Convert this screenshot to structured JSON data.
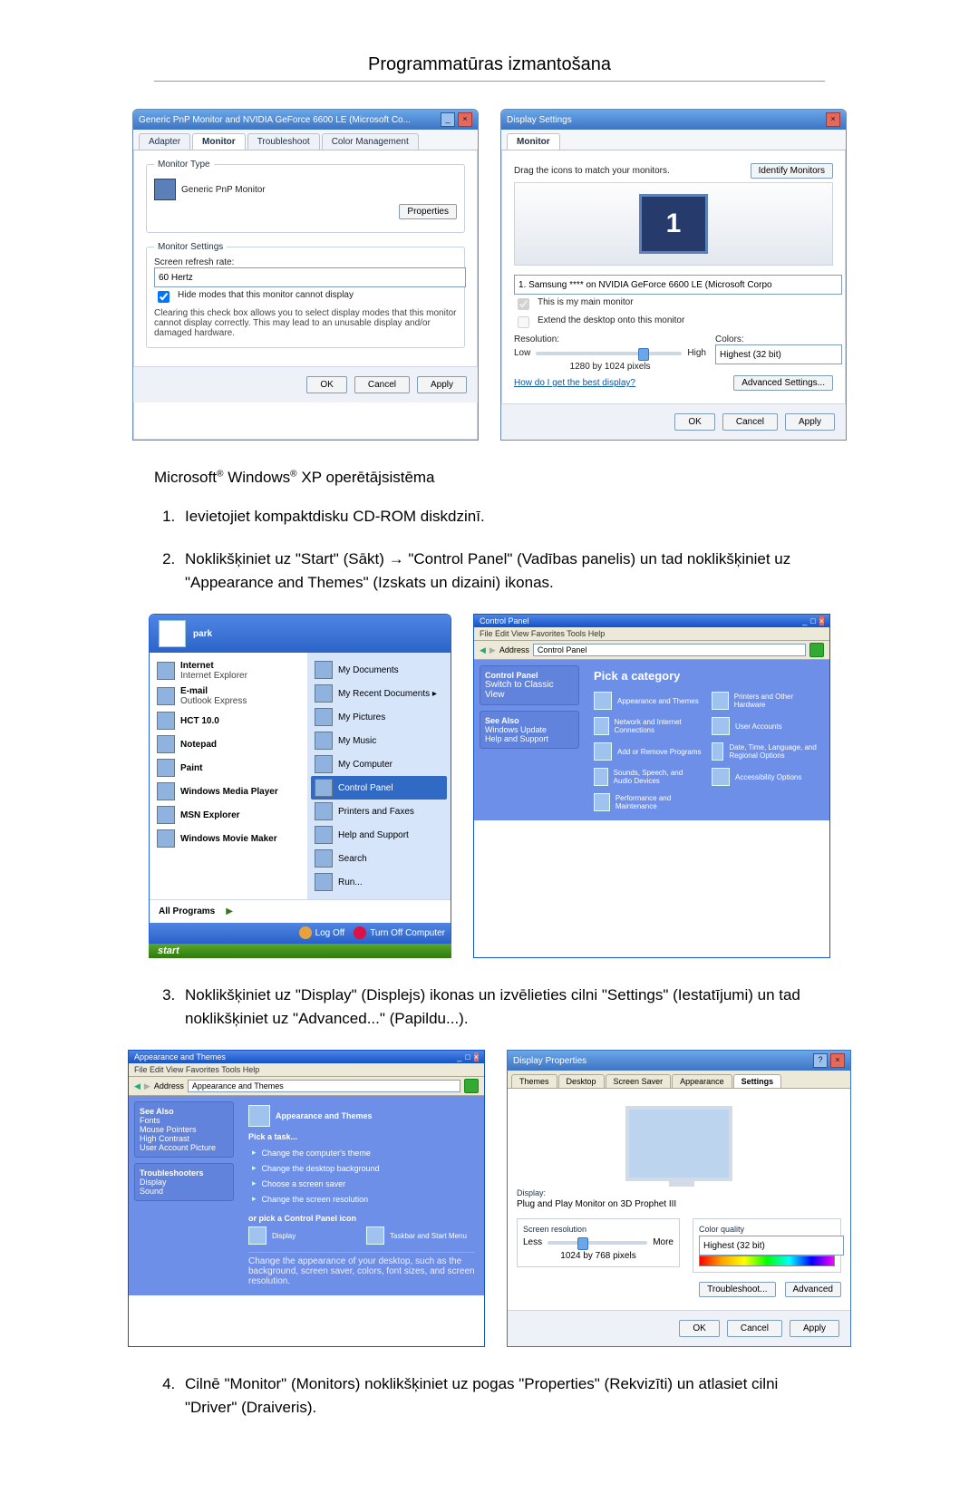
{
  "header": "Programmatūras izmantošana",
  "fig1": {
    "left": {
      "title": "Generic PnP Monitor and NVIDIA GeForce 6600 LE (Microsoft Co...",
      "tabs": [
        "Adapter",
        "Monitor",
        "Troubleshoot",
        "Color Management"
      ],
      "tab_sel": 1,
      "group1": "Monitor Type",
      "mon_name": "Generic PnP Monitor",
      "btn_props": "Properties",
      "group2": "Monitor Settings",
      "lbl_refresh": "Screen refresh rate:",
      "refresh_val": "60 Hertz",
      "chk_hide": "Hide modes that this monitor cannot display",
      "hide_desc": "Clearing this check box allows you to select display modes that this monitor cannot display correctly. This may lead to an unusable display and/or damaged hardware.",
      "ok": "OK",
      "cancel": "Cancel",
      "apply": "Apply"
    },
    "right": {
      "title": "Display Settings",
      "tab": "Monitor",
      "drag": "Drag the icons to match your monitors.",
      "btn_ident": "Identify Monitors",
      "mon_num": "1",
      "sel_mon": "1. Samsung **** on NVIDIA GeForce 6600 LE (Microsoft Corpo",
      "chk_main": "This is my main monitor",
      "chk_ext": "Extend the desktop onto this monitor",
      "lbl_res": "Resolution:",
      "lbl_low": "Low",
      "lbl_high": "High",
      "res_val": "1280 by 1024 pixels",
      "lbl_col": "Colors:",
      "col_val": "Highest (32 bit)",
      "link_best": "How do I get the best display?",
      "btn_adv": "Advanced Settings...",
      "ok": "OK",
      "cancel": "Cancel",
      "apply": "Apply"
    }
  },
  "xp_line": "Microsoft® Windows® XP operētājsistēma",
  "steps": {
    "s1": "Ievietojiet kompaktdisku CD-ROM diskdzinī.",
    "s2": "Noklikšķiniet uz \"Start\" (Sākt) → \"Control Panel\" (Vadības panelis) un tad noklikšķiniet uz \"Appearance and Themes\" (Izskats un dizaini) ikonas.",
    "s3": "Noklikšķiniet uz \"Display\" (Displejs) ikonas un izvēlieties cilni \"Settings\" (Iestatījumi) un tad noklikšķiniet uz \"Advanced...\" (Papildu...).",
    "s4": "Cilnē \"Monitor\" (Monitors) noklikšķiniet uz pogas \"Properties\" (Rekvizīti) un atlasiet cilni \"Driver\" (Draiveris)."
  },
  "fig2": {
    "start": {
      "user": "park",
      "left": [
        "Internet|Internet Explorer",
        "E-mail|Outlook Express",
        "HCT 10.0",
        "Notepad",
        "Paint",
        "Windows Media Player",
        "MSN Explorer",
        "Windows Movie Maker"
      ],
      "allp": "All Programs",
      "right": [
        "My Documents",
        "My Recent Documents  ▸",
        "My Pictures",
        "My Music",
        "My Computer",
        "Control Panel",
        "Printers and Faxes",
        "Help and Support",
        "Search",
        "Run..."
      ],
      "sel": "Control Panel",
      "logoff": "Log Off",
      "turnoff": "Turn Off Computer",
      "start": "start"
    },
    "cp": {
      "title": "Control Panel",
      "menu": "File  Edit  View  Favorites  Tools  Help",
      "addr": "Control Panel",
      "side1": "Control Panel",
      "side1a": "Switch to Classic View",
      "side2": "See Also",
      "side2a": "Windows Update",
      "side2b": "Help and Support",
      "pick": "Pick a category",
      "cats": [
        "Appearance and Themes",
        "Printers and Other Hardware",
        "Network and Internet Connections",
        "User Accounts",
        "Add or Remove Programs",
        "Date, Time, Language, and Regional Options",
        "Sounds, Speech, and Audio Devices",
        "Accessibility Options",
        "Performance and Maintenance"
      ]
    }
  },
  "fig3": {
    "at": {
      "title": "Appearance and Themes",
      "menu": "File  Edit  View  Favorites  Tools  Help",
      "addr": "Appearance and Themes",
      "side1": "See Also",
      "side1a": "Fonts",
      "side1b": "Mouse Pointers",
      "side1c": "High Contrast",
      "side1d": "User Account Picture",
      "side2": "Troubleshooters",
      "side2a": "Display",
      "side2b": "Sound",
      "cat": "Appearance and Themes",
      "pick": "Pick a task...",
      "tasks": [
        "Change the computer's theme",
        "Change the desktop background",
        "Choose a screen saver",
        "Change the screen resolution"
      ],
      "orpick": "or pick a Control Panel icon",
      "icons": [
        "Display",
        "Taskbar and Start Menu"
      ],
      "desc": "Change the appearance of your desktop, such as the background, screen saver, colors, font sizes, and screen resolution."
    },
    "dp": {
      "title": "Display Properties",
      "tabs": [
        "Themes",
        "Desktop",
        "Screen Saver",
        "Appearance",
        "Settings"
      ],
      "tab_sel": 4,
      "lbl_disp": "Display:",
      "disp_val": "Plug and Play Monitor on 3D Prophet III",
      "lbl_res": "Screen resolution",
      "lbl_less": "Less",
      "lbl_more": "More",
      "res_val": "1024 by 768 pixels",
      "lbl_cq": "Color quality",
      "cq_val": "Highest (32 bit)",
      "btn_tr": "Troubleshoot...",
      "btn_adv": "Advanced",
      "ok": "OK",
      "cancel": "Cancel",
      "apply": "Apply"
    }
  }
}
